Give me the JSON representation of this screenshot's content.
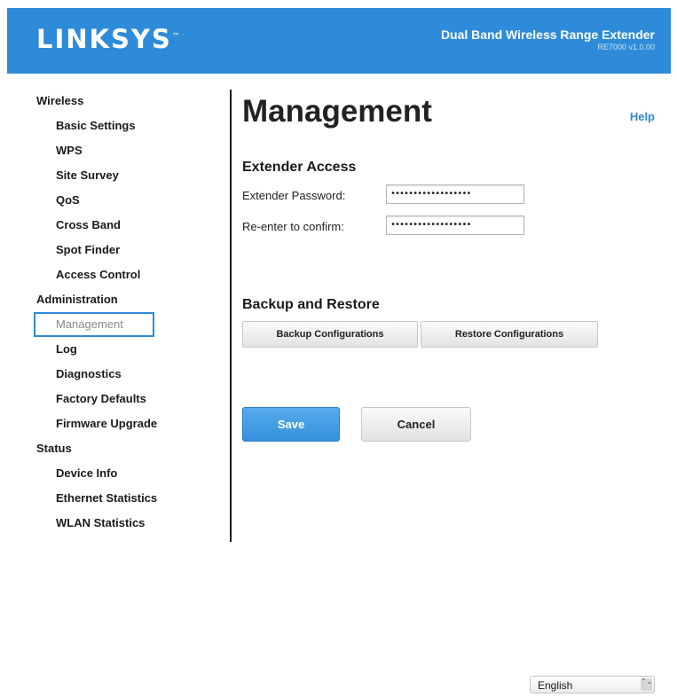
{
  "brand": {
    "logo": "LINKSYS",
    "trademark": "™"
  },
  "product": {
    "name": "Dual Band Wireless Range Extender",
    "version": "RE7000 v1.0.00"
  },
  "sidebar": {
    "sections": [
      {
        "label": "Wireless",
        "items": [
          "Basic Settings",
          "WPS",
          "Site Survey",
          "QoS",
          "Cross Band",
          "Spot Finder",
          "Access Control"
        ]
      },
      {
        "label": "Administration",
        "items": [
          "Management",
          "Log",
          "Diagnostics",
          "Factory Defaults",
          "Firmware Upgrade"
        ]
      },
      {
        "label": "Status",
        "items": [
          "Device Info",
          "Ethernet Statistics",
          "WLAN Statistics"
        ]
      }
    ],
    "active_item": "Management"
  },
  "page": {
    "title": "Management",
    "help_label": "Help"
  },
  "extender_access": {
    "title": "Extender Access",
    "password_label": "Extender Password:",
    "password_value": "••••••••••••••••••",
    "confirm_label": "Re-enter to confirm:",
    "confirm_value": "••••••••••••••••••"
  },
  "backup_restore": {
    "title": "Backup and Restore",
    "backup_label": "Backup Configurations",
    "restore_label": "Restore Configurations"
  },
  "actions": {
    "save_label": "Save",
    "cancel_label": "Cancel"
  },
  "language": {
    "selected": "English",
    "arrow": "⌃⌄"
  },
  "colors": {
    "accent": "#2e8bd9",
    "header_bg": "#2e8bd9"
  }
}
